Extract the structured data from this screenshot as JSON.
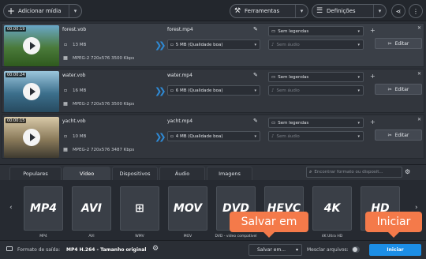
{
  "toolbar": {
    "add_media_label": "Adicionar mídia",
    "tools_label": "Ferramentas",
    "settings_label": "Definições"
  },
  "files": [
    {
      "time": "00:00:19",
      "name": "forest.vob",
      "size": "13 MB",
      "codec": "MPEG-2 720x576 3500 Kbps",
      "output_name": "forest.mp4",
      "output_size": "5 MB (Qualidade boa)",
      "subtitles": "Sem legendas",
      "audio": "Sem áudio",
      "edit_label": "Editar",
      "thumb_colors": [
        "#6aa7c9",
        "#4a7a3a",
        "#2f5a1e"
      ]
    },
    {
      "time": "00:00:24",
      "name": "water.vob",
      "size": "16 MB",
      "codec": "MPEG-2 720x576 3500 Kbps",
      "output_name": "water.mp4",
      "output_size": "6 MB (Qualidade boa)",
      "subtitles": "Sem legendas",
      "audio": "Sem áudio",
      "edit_label": "Editar",
      "thumb_colors": [
        "#9bc6dc",
        "#3c6f8c",
        "#274a5f"
      ]
    },
    {
      "time": "00:00:15",
      "name": "yacht.vob",
      "size": "10 MB",
      "codec": "MPEG-2 720x576 3487 Kbps",
      "output_name": "yacht.mp4",
      "output_size": "4 MB (Qualidade boa)",
      "subtitles": "Sem legendas",
      "audio": "Sem áudio",
      "edit_label": "Editar",
      "thumb_colors": [
        "#d8c9a8",
        "#8a7a5a",
        "#3e3a30"
      ]
    }
  ],
  "format_tabs": [
    "Populares",
    "Vídeo",
    "Dispositivos",
    "Áudio",
    "Imagens"
  ],
  "active_tab": "Vídeo",
  "search": {
    "placeholder": "Encontrar formato ou disposit..."
  },
  "formats": [
    {
      "badge": "MP4",
      "caption": "MP4"
    },
    {
      "badge": "AVI",
      "caption": "AVI"
    },
    {
      "badge": "WIN",
      "caption": "WMV"
    },
    {
      "badge": "MOV",
      "caption": "MOV"
    },
    {
      "badge": "DVD",
      "caption": "DVD - video compatível"
    },
    {
      "badge": "HEVC",
      "caption": ""
    },
    {
      "badge": "4K",
      "caption": "4K Ultra HD"
    },
    {
      "badge": "HD",
      "caption": ""
    }
  ],
  "bottom": {
    "output_label": "Formato de saída:",
    "output_value": "MP4 H.264 - Tamanho original",
    "save_label": "Salvar em...",
    "merge_label": "Mesclar arquivos:",
    "start_label": "Iniciar"
  },
  "callouts": {
    "save": "Salvar em",
    "start": "Iniciar"
  },
  "colors": {
    "accent": "#1c8ee6",
    "callout": "#f47a4a",
    "arrow": "#2f8bd6"
  }
}
